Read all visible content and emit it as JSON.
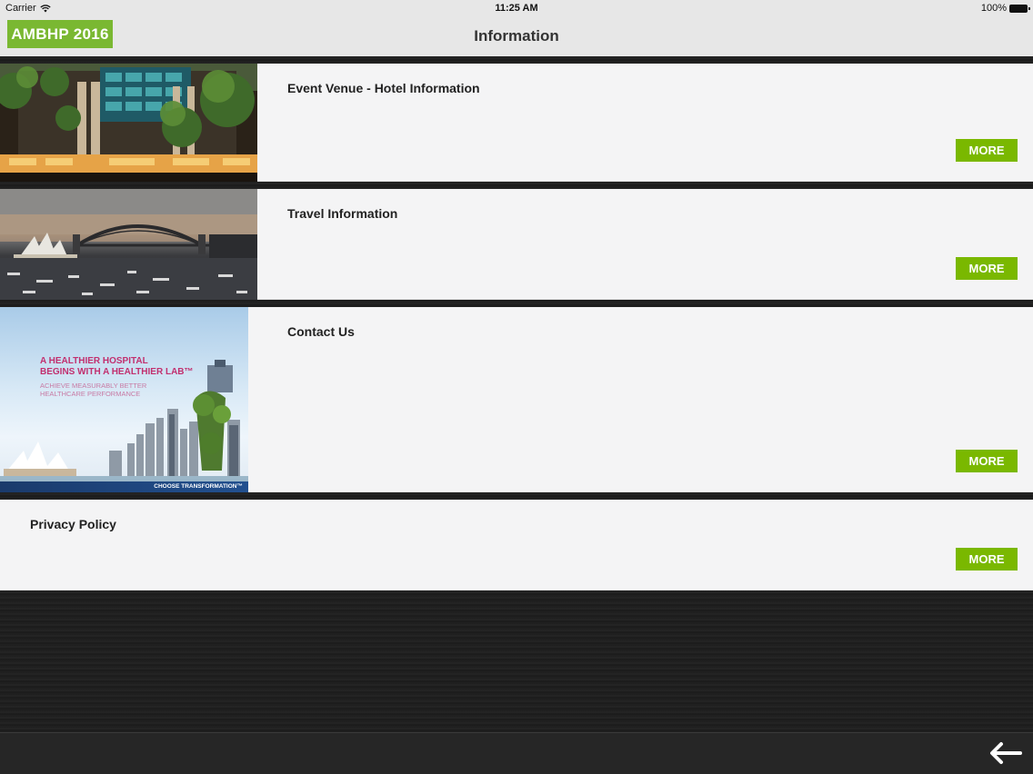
{
  "status_bar": {
    "carrier": "Carrier",
    "time": "11:25 AM",
    "battery": "100%"
  },
  "nav": {
    "logo": "AMBHP 2016",
    "title": "Information"
  },
  "cards": [
    {
      "title": "Event Venue - Hotel Information",
      "more": "MORE",
      "image": "hotel-exterior"
    },
    {
      "title": "Travel Information",
      "more": "MORE",
      "image": "sydney-harbour"
    },
    {
      "title": "Contact Us",
      "more": "MORE",
      "image": "healthier-hospital-ad"
    },
    {
      "title": "Privacy Policy",
      "more": "MORE"
    }
  ],
  "ad": {
    "headline_line1": "A HEALTHIER HOSPITAL",
    "headline_line2": "BEGINS WITH A HEALTHIER LAB™",
    "sub_line1": "ACHIEVE MEASURABLY BETTER",
    "sub_line2": "HEALTHCARE PERFORMANCE",
    "footer": "CHOOSE TRANSFORMATION™"
  },
  "toolbar": {
    "back_icon": "back-arrow-icon"
  },
  "colors": {
    "accent": "#7ab800",
    "nav_background": "#e7e7e7",
    "card_background": "#f4f4f5",
    "page_background": "#1d1d1d"
  }
}
